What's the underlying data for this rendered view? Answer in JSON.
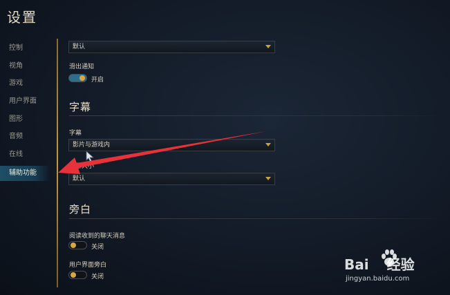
{
  "page": {
    "title": "设置"
  },
  "sidebar": {
    "items": [
      {
        "label": "控制",
        "active": false
      },
      {
        "label": "视角",
        "active": false
      },
      {
        "label": "游戏",
        "active": false
      },
      {
        "label": "用户界面",
        "active": false
      },
      {
        "label": "图形",
        "active": false
      },
      {
        "label": "音频",
        "active": false
      },
      {
        "label": "在线",
        "active": false
      },
      {
        "label": "辅助功能",
        "active": true
      }
    ]
  },
  "top_dropdown": {
    "value": "默认"
  },
  "slide_notification": {
    "label": "滑出通知",
    "toggle_text": "开启",
    "on": true
  },
  "subtitles_section": {
    "title": "字幕",
    "subtitles": {
      "label": "字幕",
      "value": "影片与游戏内"
    },
    "subtitle_size": {
      "label": "字幕大小",
      "value": "默认"
    }
  },
  "narration_section": {
    "title": "旁白",
    "read_chat": {
      "label": "阅读收到的聊天消息",
      "toggle_text": "关闭",
      "on": false
    },
    "ui_narration": {
      "label": "用户界面旁白",
      "toggle_text": "关闭",
      "on": false
    }
  },
  "watermark": {
    "logo": "Bai",
    "brand": "经验",
    "url": "jingyan.baidu.com"
  },
  "colors": {
    "accent_gold": "#c79a3d",
    "toggle_on": "#2d6e8c",
    "active_nav": "#1e4f66",
    "arrow_red": "#e8323a"
  }
}
